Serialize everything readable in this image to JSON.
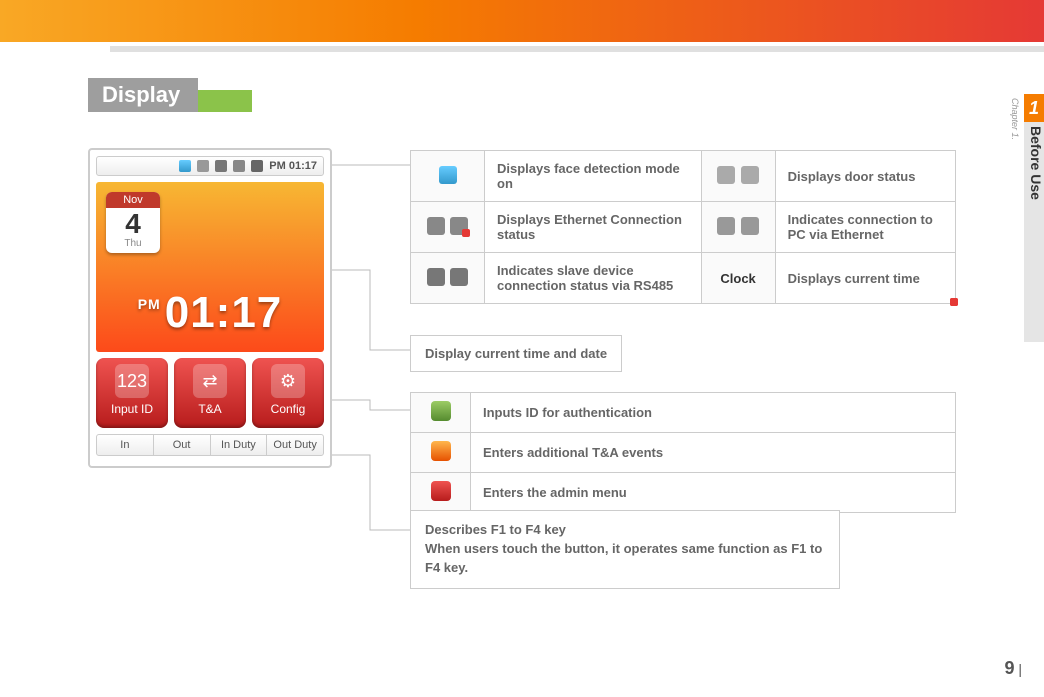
{
  "section_title": "Display",
  "side_tab": {
    "chapter_number": "1",
    "chapter_label": "Chapter 1.",
    "section_label": "Before Use"
  },
  "device": {
    "statusbar_time": "PM 01:17",
    "calendar": {
      "month": "Nov",
      "day": "4",
      "weekday": "Thu"
    },
    "bigtime": {
      "ampm": "PM",
      "time": "01:17"
    },
    "main_buttons": [
      {
        "label": "Input ID",
        "glyph": "123"
      },
      {
        "label": "T&A",
        "glyph": "⇄"
      },
      {
        "label": "Config",
        "glyph": "⚙"
      }
    ],
    "func_buttons": [
      "In",
      "Out",
      "In Duty",
      "Out Duty"
    ]
  },
  "icon_table": {
    "rows": [
      {
        "left_desc": "Displays face detection mode on",
        "right_label": "",
        "right_desc": "Displays door status"
      },
      {
        "left_desc": "Displays Ethernet Connection status",
        "right_label": "",
        "right_desc": "Indicates connection to PC via Ethernet"
      },
      {
        "left_desc": "Indicates slave device connection status via RS485",
        "right_label": "Clock",
        "right_desc": "Displays current time"
      }
    ]
  },
  "callout_date": "Display current time and date",
  "menu_table": {
    "rows": [
      {
        "desc": "Inputs ID for authentication"
      },
      {
        "desc": "Enters additional T&A events"
      },
      {
        "desc": "Enters the admin menu"
      }
    ]
  },
  "func_desc": {
    "line1": "Describes F1 to F4 key",
    "line2": "When users touch the button, it operates same function as F1 to F4 key."
  },
  "page_number": "9"
}
